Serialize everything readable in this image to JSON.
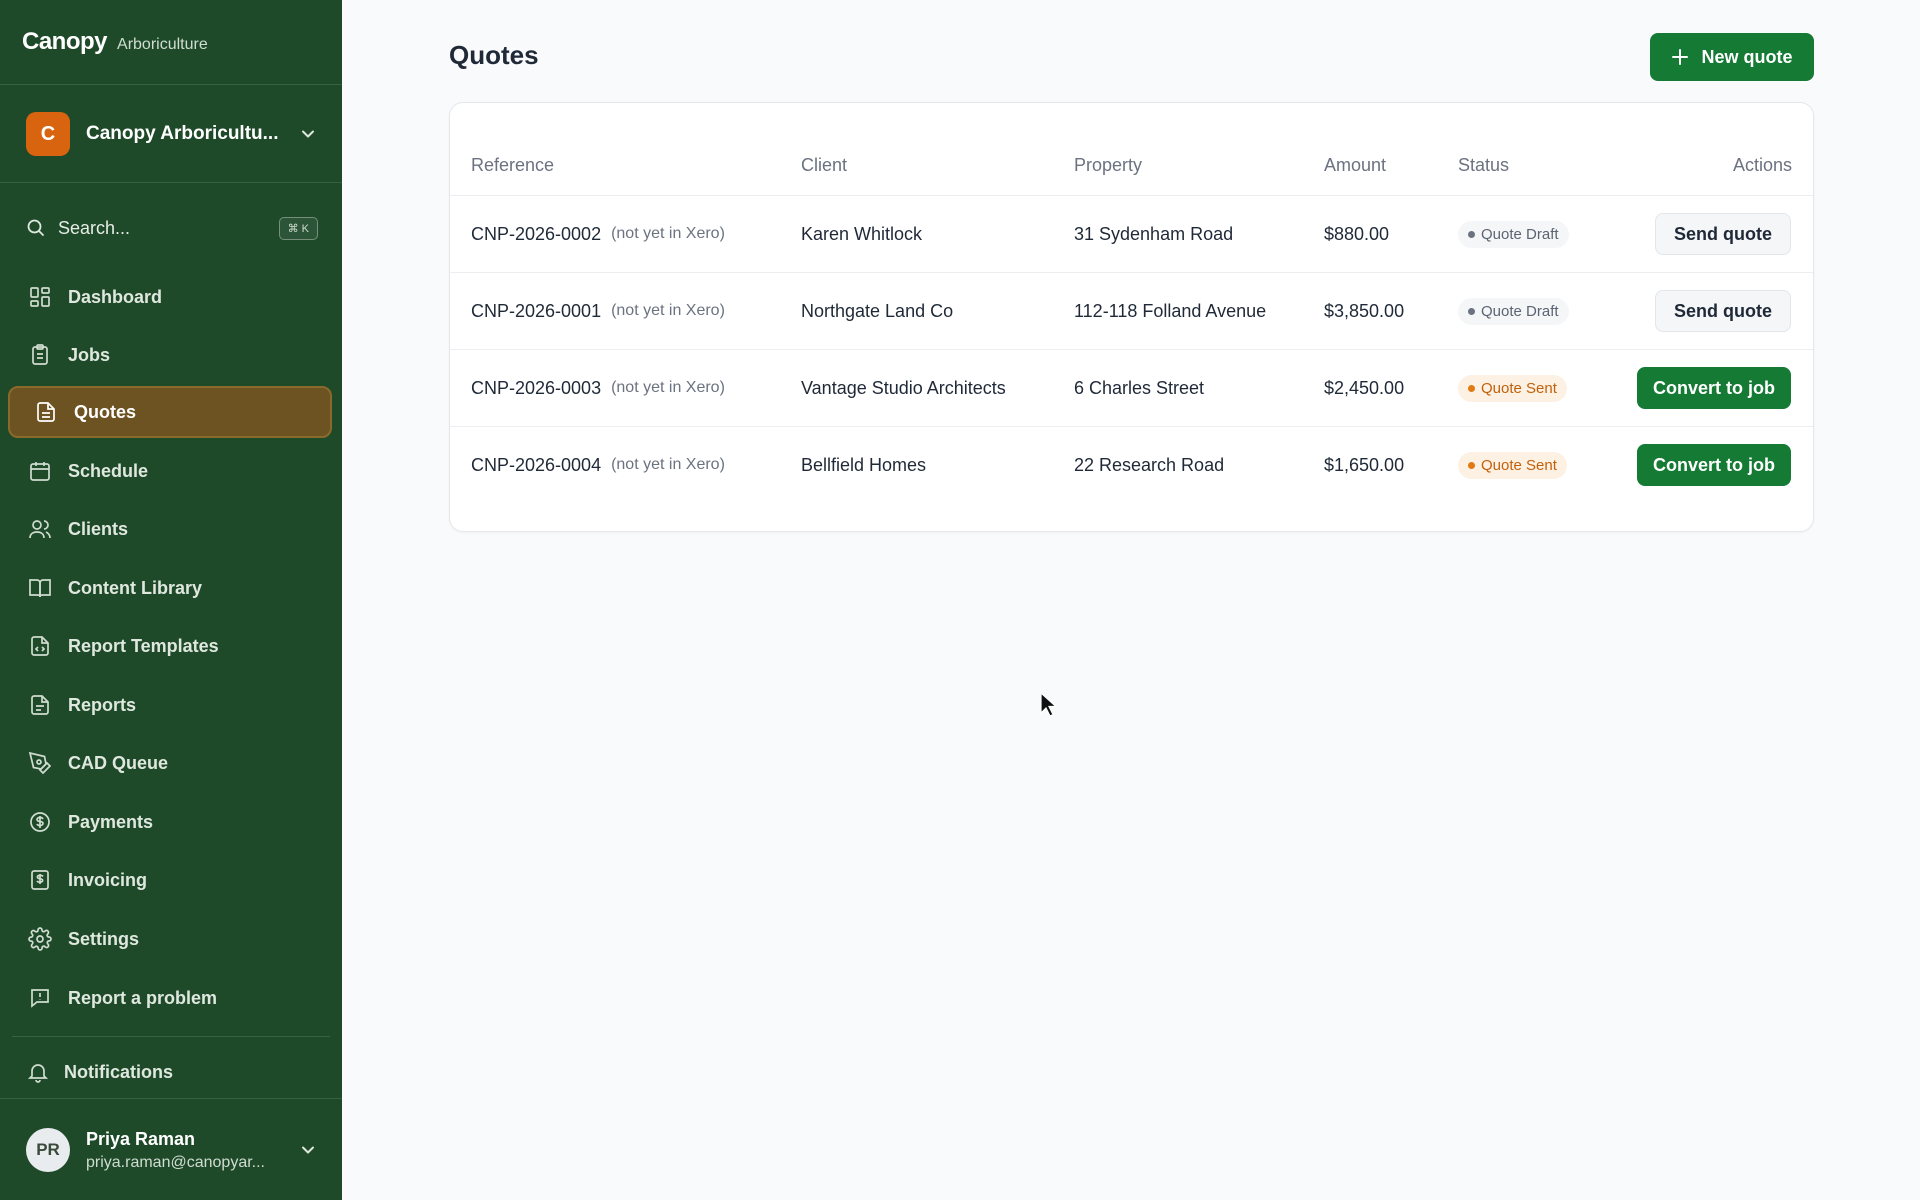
{
  "brand": {
    "name": "Canopy",
    "subtitle": "Arboriculture"
  },
  "org": {
    "initial": "C",
    "name": "Canopy Arboricultu..."
  },
  "search": {
    "placeholder": "Search...",
    "shortcut": "⌘ K"
  },
  "nav": [
    {
      "label": "Dashboard",
      "icon": "dashboard-icon",
      "active": false
    },
    {
      "label": "Jobs",
      "icon": "clipboard-icon",
      "active": false
    },
    {
      "label": "Quotes",
      "icon": "document-icon",
      "active": true
    },
    {
      "label": "Schedule",
      "icon": "calendar-icon",
      "active": false
    },
    {
      "label": "Clients",
      "icon": "users-icon",
      "active": false
    },
    {
      "label": "Content Library",
      "icon": "book-icon",
      "active": false
    },
    {
      "label": "Report Templates",
      "icon": "file-code-icon",
      "active": false
    },
    {
      "label": "Reports",
      "icon": "report-icon",
      "active": false
    },
    {
      "label": "CAD Queue",
      "icon": "pen-tool-icon",
      "active": false
    },
    {
      "label": "Payments",
      "icon": "dollar-circle-icon",
      "active": false
    },
    {
      "label": "Invoicing",
      "icon": "invoice-icon",
      "active": false
    },
    {
      "label": "Settings",
      "icon": "gear-icon",
      "active": false
    },
    {
      "label": "Report a problem",
      "icon": "alert-message-icon",
      "active": false
    }
  ],
  "notifications": {
    "label": "Notifications"
  },
  "user": {
    "initials": "PR",
    "name": "Priya Raman",
    "email": "priya.raman@canopyar..."
  },
  "page": {
    "title": "Quotes",
    "new_button": "New quote"
  },
  "table": {
    "columns": {
      "reference": "Reference",
      "client": "Client",
      "property": "Property",
      "amount": "Amount",
      "status": "Status",
      "actions": "Actions"
    },
    "rows": [
      {
        "reference": "CNP-2026-0002",
        "note": "(not yet in Xero)",
        "client": "Karen Whitlock",
        "property": "31 Sydenham Road",
        "amount": "$880.00",
        "status": "Quote Draft",
        "status_kind": "draft",
        "action": "Send quote",
        "action_kind": "outline"
      },
      {
        "reference": "CNP-2026-0001",
        "note": "(not yet in Xero)",
        "client": "Northgate Land Co",
        "property": "112-118 Folland Avenue",
        "amount": "$3,850.00",
        "status": "Quote Draft",
        "status_kind": "draft",
        "action": "Send quote",
        "action_kind": "outline"
      },
      {
        "reference": "CNP-2026-0003",
        "note": "(not yet in Xero)",
        "client": "Vantage Studio Architects",
        "property": "6 Charles Street",
        "amount": "$2,450.00",
        "status": "Quote Sent",
        "status_kind": "sent",
        "action": "Convert to job",
        "action_kind": "solid"
      },
      {
        "reference": "CNP-2026-0004",
        "note": "(not yet in Xero)",
        "client": "Bellfield Homes",
        "property": "22 Research Road",
        "amount": "$1,650.00",
        "status": "Quote Sent",
        "status_kind": "sent",
        "action": "Convert to job",
        "action_kind": "solid"
      }
    ]
  },
  "colors": {
    "sidebar": "#1f4a2a",
    "active_nav": "#6d5321",
    "primary": "#157a34",
    "org_avatar": "#d9640f",
    "sent_badge": "#c2610a"
  }
}
